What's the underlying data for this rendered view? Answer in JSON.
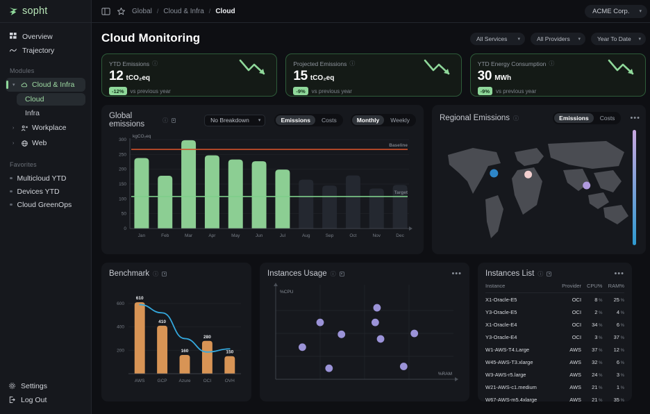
{
  "brand": {
    "name": "sopht"
  },
  "sidebar": {
    "nav": [
      {
        "label": "Overview",
        "icon": "grid-icon"
      },
      {
        "label": "Trajectory",
        "icon": "trend-icon"
      }
    ],
    "modules_label": "Modules",
    "modules": [
      {
        "label": "Cloud & Infra",
        "icon": "cloud-icon",
        "active": true
      },
      {
        "label": "Workplace",
        "icon": "workplace-icon",
        "active": false
      },
      {
        "label": "Web",
        "icon": "globe-icon",
        "active": false
      }
    ],
    "sub_items": [
      {
        "label": "Cloud",
        "active": true
      },
      {
        "label": "Infra",
        "active": false
      }
    ],
    "favorites_label": "Favorites",
    "favorites": [
      {
        "label": "Multicloud YTD"
      },
      {
        "label": "Devices YTD"
      },
      {
        "label": "Cloud GreenOps"
      }
    ],
    "bottom": [
      {
        "label": "Settings",
        "icon": "gear-icon"
      },
      {
        "label": "Log Out",
        "icon": "logout-icon"
      }
    ]
  },
  "topbar": {
    "panel_toggle_icon": "sidebar-toggle-icon",
    "favorite_icon": "star-icon",
    "breadcrumbs": [
      "Global",
      "Cloud & Infra",
      "Cloud"
    ],
    "separator": "/",
    "org": "ACME Corp."
  },
  "page": {
    "title": "Cloud Monitoring",
    "filters": [
      {
        "label": "All Services"
      },
      {
        "label": "All Providers"
      },
      {
        "label": "Year To Date"
      }
    ]
  },
  "kpis": [
    {
      "label": "YTD Emissions",
      "value": "12",
      "unit": "tCO₂eq",
      "delta": "-12%",
      "delta_note": "vs previous year"
    },
    {
      "label": "Projected Emissions",
      "value": "15",
      "unit": "tCO₂eq",
      "delta": "-9%",
      "delta_note": "vs previous year"
    },
    {
      "label": "YTD Energy Consumption",
      "value": "30",
      "unit": "MWh",
      "delta": "-9%",
      "delta_note": "vs previous year"
    }
  ],
  "global_emissions": {
    "title": "Global emissions",
    "breakdown": "No Breakdown",
    "metric_toggle": [
      {
        "label": "Emissions",
        "on": true
      },
      {
        "label": "Costs",
        "on": false
      }
    ],
    "period_toggle": [
      {
        "label": "Monthly",
        "on": true
      },
      {
        "label": "Weekly",
        "on": false
      }
    ]
  },
  "regional": {
    "title": "Regional Emissions",
    "metric_toggle": [
      {
        "label": "Emissions",
        "on": true
      },
      {
        "label": "Costs",
        "on": false
      }
    ],
    "menu": "•••"
  },
  "benchmark": {
    "title": "Benchmark"
  },
  "instances_usage": {
    "title": "Instances Usage",
    "menu": "•••"
  },
  "instances_list": {
    "title": "Instances List",
    "menu": "•••",
    "columns": [
      "Instance",
      "Provider",
      "CPU%",
      "RAM%"
    ],
    "rows": [
      {
        "instance": "X1-Oracle-E5",
        "provider": "OCI",
        "cpu": "8",
        "ram": "25"
      },
      {
        "instance": "Y3-Oracle-E5",
        "provider": "OCI",
        "cpu": "2",
        "ram": "4"
      },
      {
        "instance": "X1-Oracle-E4",
        "provider": "OCI",
        "cpu": "34",
        "ram": "6"
      },
      {
        "instance": "Y3-Oracle-E4",
        "provider": "OCI",
        "cpu": "3",
        "ram": "37"
      },
      {
        "instance": "W1-AWS-T4.Large",
        "provider": "AWS",
        "cpu": "37",
        "ram": "12"
      },
      {
        "instance": "W45-AWS-T3.xlarge",
        "provider": "AWS",
        "cpu": "32",
        "ram": "6"
      },
      {
        "instance": "W3-AWS-r5.large",
        "provider": "AWS",
        "cpu": "24",
        "ram": "3"
      },
      {
        "instance": "W21-AWS-c1.medium",
        "provider": "AWS",
        "cpu": "21",
        "ram": "1"
      },
      {
        "instance": "W67-AWS-m5.4xlarge",
        "provider": "AWS",
        "cpu": "21",
        "ram": "35"
      }
    ]
  },
  "colors": {
    "accent_green": "#8fd89a",
    "bar_green": "#8cce93",
    "bar_muted": "#242830",
    "baseline_red": "#d1502a",
    "target_green": "#7ece8a",
    "bench_orange": "#d89455",
    "bench_line_blue": "#34a8dd",
    "scatter_purple": "#9b93d8",
    "map_land": "#53565c",
    "panel_bg": "#16181d"
  },
  "chart_data": [
    {
      "type": "bar",
      "id": "global-emissions",
      "title": "Global emissions",
      "ylabel": "kgCO₂eq",
      "xlabel": "",
      "ylim": [
        0,
        300
      ],
      "yticks": [
        0,
        50,
        100,
        150,
        200,
        250,
        300
      ],
      "grid": true,
      "categories": [
        "Jan",
        "Feb",
        "Mar",
        "Apr",
        "May",
        "Jun",
        "Jul",
        "Aug",
        "Sep",
        "Oct",
        "Nov",
        "Dec"
      ],
      "values": [
        238,
        178,
        298,
        247,
        233,
        227,
        199,
        165,
        145,
        179,
        135,
        147
      ],
      "actual_count": 7,
      "annotations": [
        {
          "label": "Baseline",
          "value": 267,
          "color": "#d1502a"
        },
        {
          "label": "Target",
          "value": 108,
          "color": "#7ece8a"
        }
      ]
    },
    {
      "type": "bar",
      "id": "benchmark",
      "title": "Benchmark",
      "ylim": [
        0,
        700
      ],
      "yticks": [
        200,
        400,
        600
      ],
      "grid": true,
      "categories": [
        "AWS",
        "GCP",
        "Azure",
        "OCI",
        "OVH"
      ],
      "values": [
        610,
        410,
        160,
        280,
        150
      ],
      "data_labels": [
        "610",
        "410",
        "160",
        "280",
        "150"
      ],
      "series": [
        {
          "name": "trend",
          "type": "line",
          "color": "#34a8dd",
          "values": [
            590,
            520,
            300,
            185,
            212
          ]
        }
      ]
    },
    {
      "type": "scatter",
      "id": "instances-usage",
      "title": "Instances Usage",
      "xlabel": "%RAM",
      "ylabel": "%CPU",
      "grid": true,
      "points": [
        {
          "x": 15,
          "y": 35
        },
        {
          "x": 30,
          "y": 12
        },
        {
          "x": 25,
          "y": 62
        },
        {
          "x": 37,
          "y": 49
        },
        {
          "x": 57,
          "y": 78
        },
        {
          "x": 56,
          "y": 62
        },
        {
          "x": 59,
          "y": 44
        },
        {
          "x": 72,
          "y": 14
        },
        {
          "x": 78,
          "y": 50
        }
      ]
    },
    {
      "type": "map",
      "id": "regional-emissions",
      "title": "Regional Emissions",
      "markers": [
        {
          "x": 27,
          "y": 38,
          "color": "#2e86c8",
          "size": 9
        },
        {
          "x": 44,
          "y": 39,
          "color": "#f2cfcf",
          "size": 8
        },
        {
          "x": 73,
          "y": 48,
          "color": "#b09ade",
          "size": 8
        }
      ],
      "legend": {
        "type": "gradient",
        "from": "#c9a8e0",
        "to": "#2e9ad0",
        "position": "right"
      }
    }
  ]
}
